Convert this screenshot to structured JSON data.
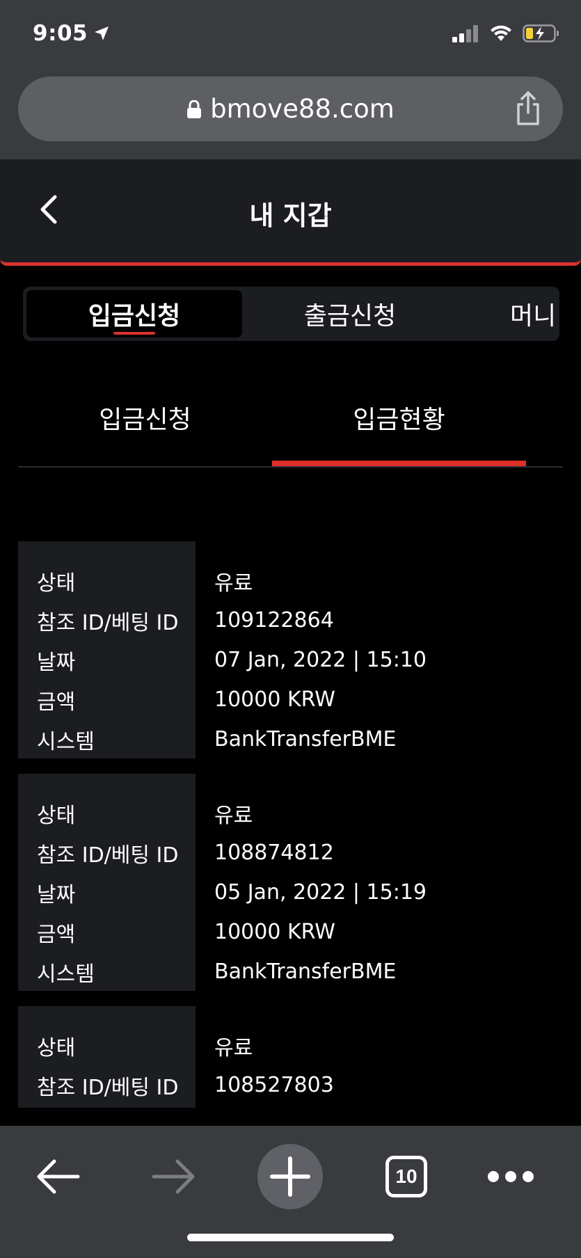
{
  "status_bar": {
    "time": "9:05"
  },
  "browser": {
    "url": "bmove88.com"
  },
  "header": {
    "title": "내 지갑"
  },
  "seg_tabs": [
    "입금신청",
    "출금신청",
    "머니"
  ],
  "sub_tabs": [
    "입금신청",
    "입금현황"
  ],
  "labels": {
    "status": "상태",
    "ref_id": "참조 ID/베팅 ID",
    "date": "날짜",
    "amount": "금액",
    "system": "시스템"
  },
  "records": [
    {
      "status": "유료",
      "ref_id": "109122864",
      "date": "07 Jan, 2022 | 15:10",
      "amount": "10000 KRW",
      "system": "BankTransferBME"
    },
    {
      "status": "유료",
      "ref_id": "108874812",
      "date": "05 Jan, 2022 | 15:19",
      "amount": "10000 KRW",
      "system": "BankTransferBME"
    },
    {
      "status": "유료",
      "ref_id": "108527803"
    }
  ],
  "toolbar": {
    "tabs_count": "10"
  },
  "colors": {
    "accent": "#e02e28",
    "panel": "#1c1d21",
    "chrome": "#3a3b3f"
  }
}
